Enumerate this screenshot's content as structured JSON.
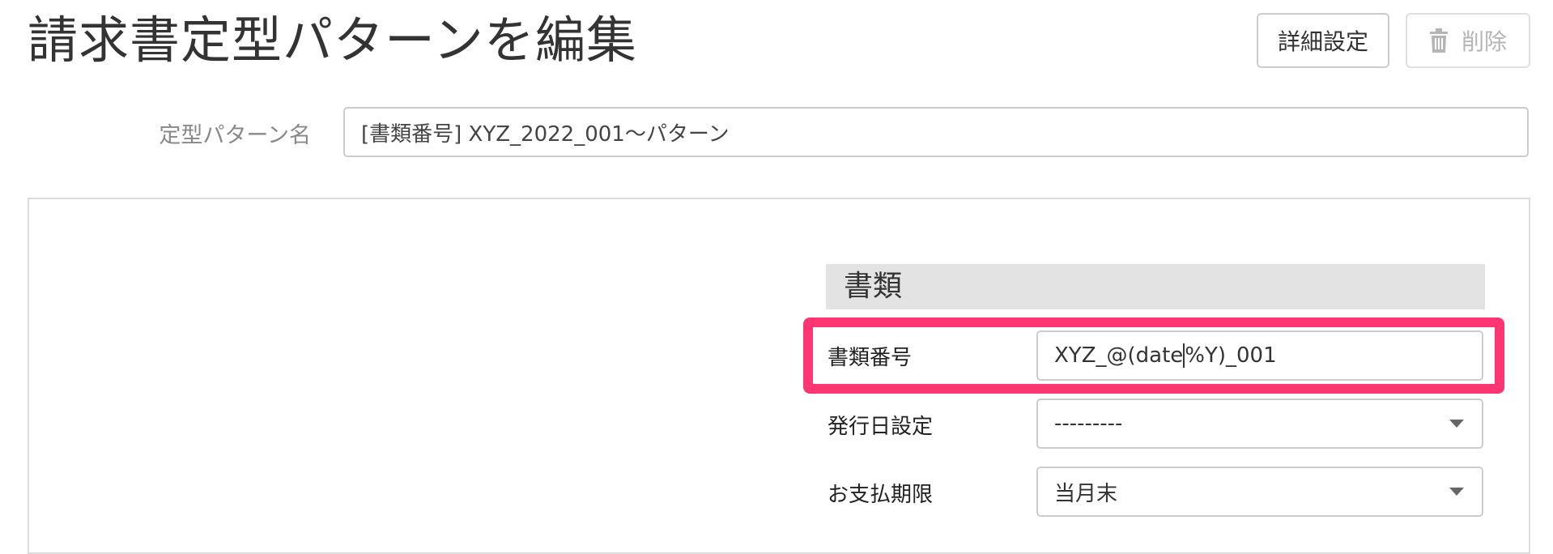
{
  "page": {
    "title": "請求書定型パターンを編集"
  },
  "toolbar": {
    "detail_label": "詳細設定",
    "delete_label": "削除",
    "delete_icon": "trash-icon"
  },
  "pattern": {
    "label": "定型パターン名",
    "value": "[書類番号] XYZ_2022_001〜パターン"
  },
  "section": {
    "title": "書類",
    "fields": [
      {
        "label": "書類番号",
        "value": "XYZ_@(date|%Y)_001",
        "type": "text",
        "highlighted": true
      },
      {
        "label": "発行日設定",
        "value": "---------",
        "type": "select"
      },
      {
        "label": "お支払期限",
        "value": "当月末",
        "type": "select"
      }
    ]
  },
  "colors": {
    "highlight": "#ff3672",
    "section_bg": "#e3e3e3",
    "disabled_text": "#b5b5b5"
  }
}
